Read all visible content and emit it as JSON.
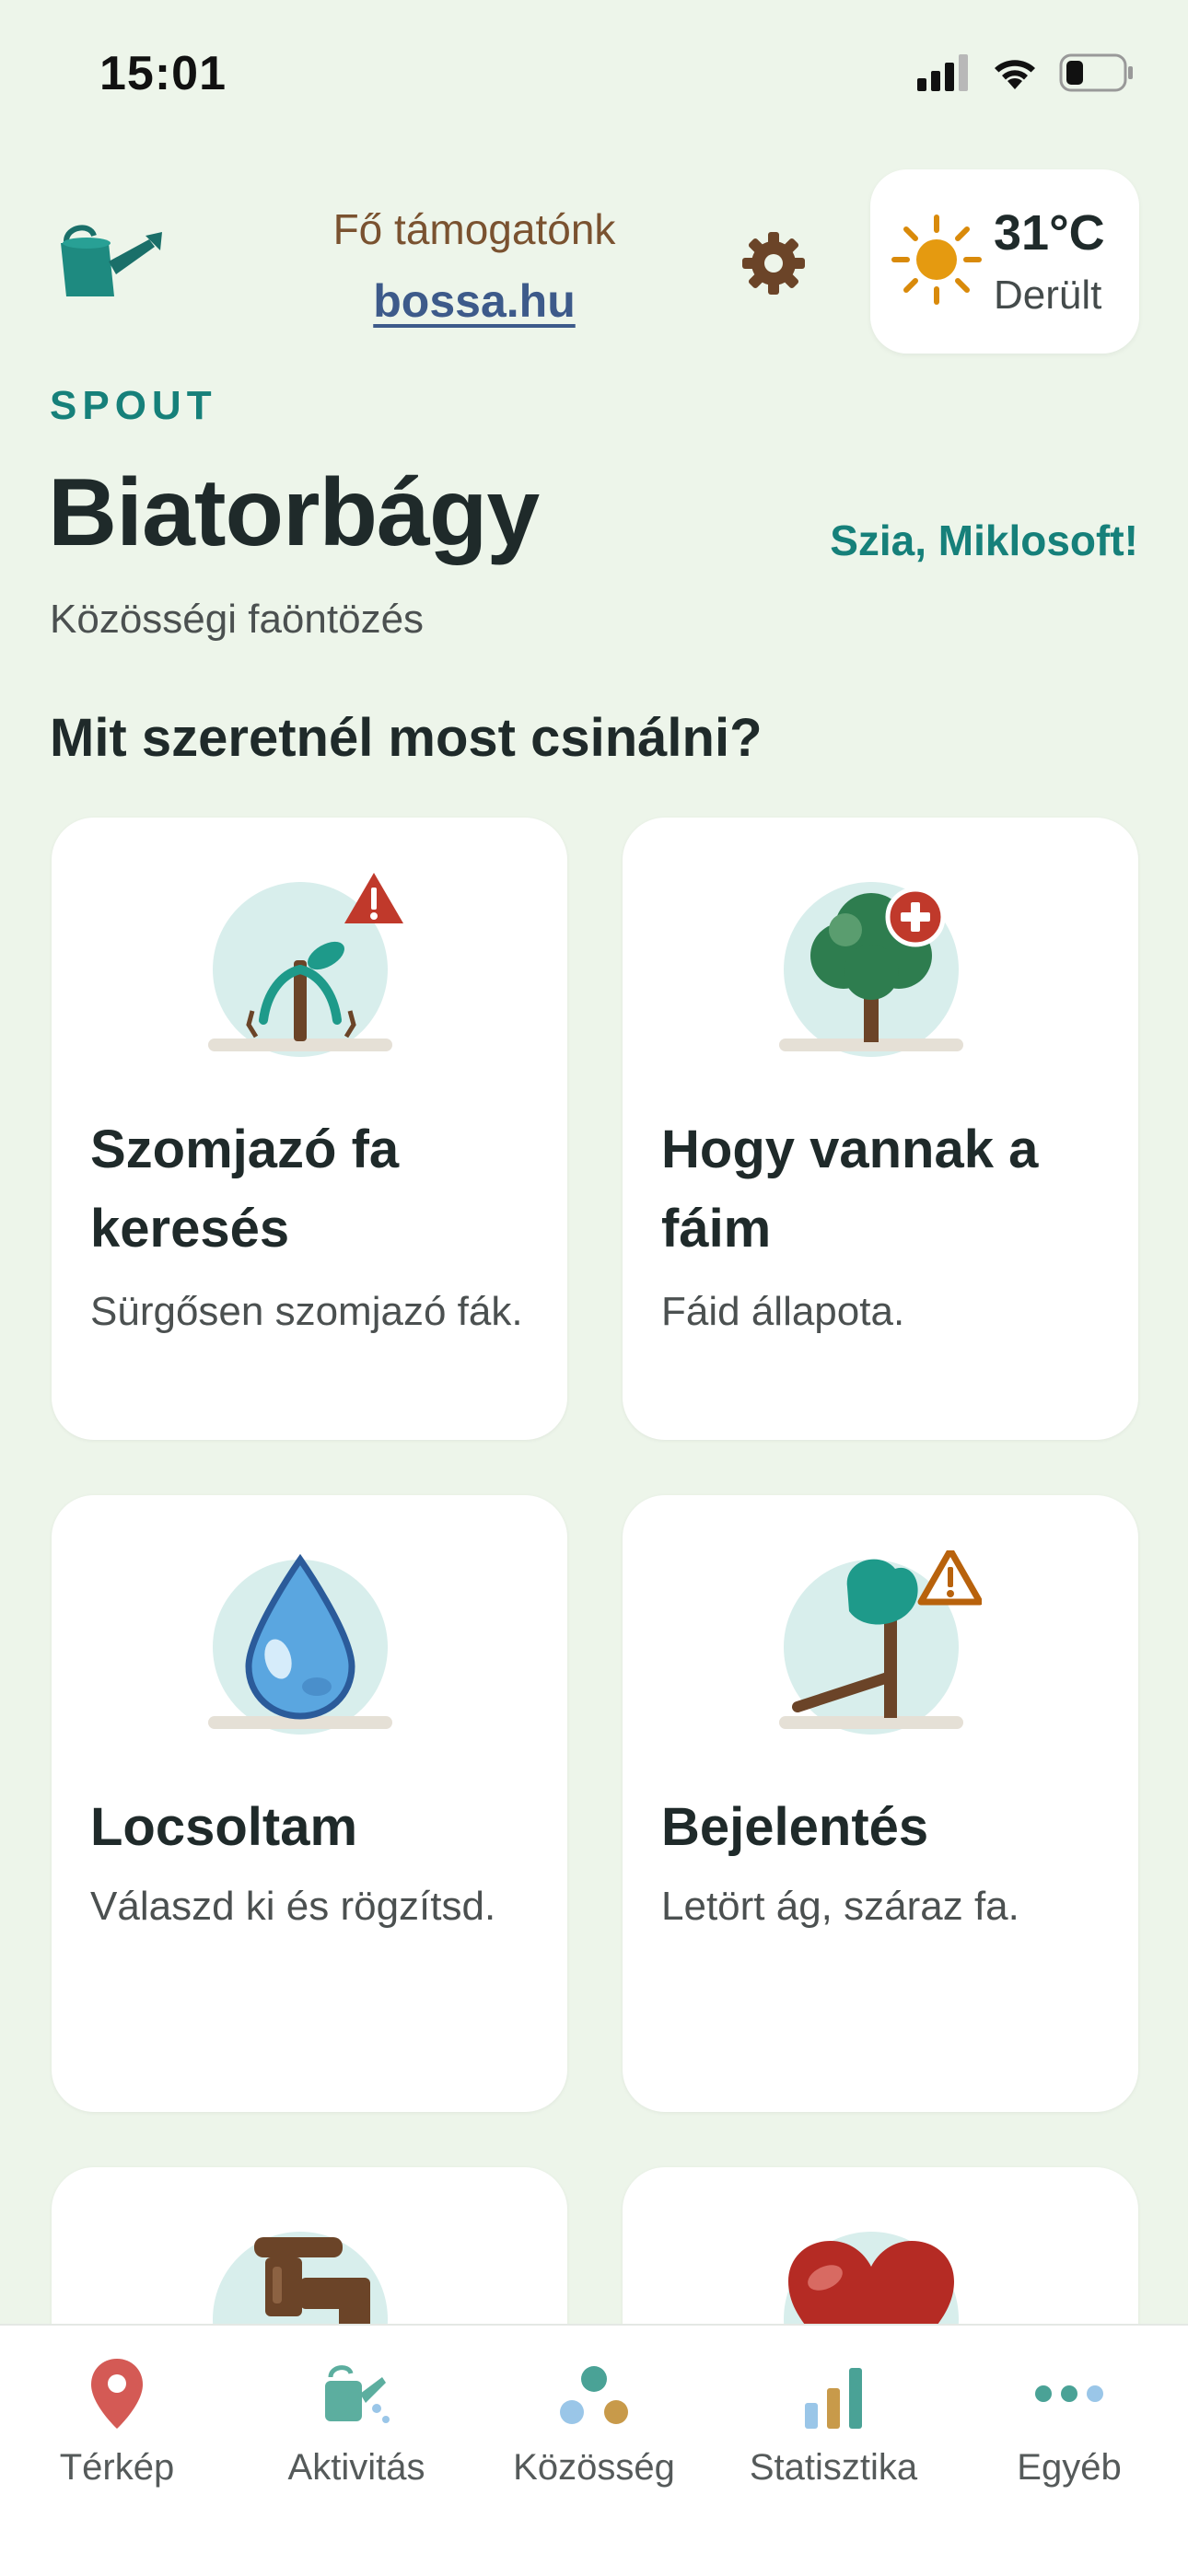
{
  "status_bar": {
    "time": "15:01"
  },
  "header": {
    "sponsor_label": "Fő támogatónk",
    "sponsor_link": "bossa.hu",
    "weather": {
      "temperature": "31°C",
      "condition": "Derült"
    }
  },
  "brand": "SPOUT",
  "city": "Biatorbágy",
  "greeting": "Szia, Miklosoft!",
  "subtitle": "Közösségi faöntözés",
  "question": "Mit szeretnél most csinálni?",
  "cards": [
    {
      "title": "Szomjazó fa keresés",
      "desc": "Sürgősen szomjazó fák."
    },
    {
      "title": "Hogy vannak a fáim",
      "desc": "Fáid állapota."
    },
    {
      "title": "Locsoltam",
      "desc": "Válaszd ki és rögzítsd."
    },
    {
      "title": "Bejelentés",
      "desc": "Letört ág, száraz fa."
    }
  ],
  "tabs": [
    {
      "label": "Térkép",
      "icon": "map-pin-icon"
    },
    {
      "label": "Aktivitás",
      "icon": "watering-can-icon"
    },
    {
      "label": "Közösség",
      "icon": "community-dots-icon"
    },
    {
      "label": "Statisztika",
      "icon": "bar-chart-icon"
    },
    {
      "label": "Egyéb",
      "icon": "more-dots-icon"
    }
  ],
  "colors": {
    "background": "#edf5ea",
    "accent_teal": "#16807a",
    "sponsor_brown": "#7a5230",
    "link_blue": "#3d5a8a",
    "alert_red": "#c0392b",
    "warning_orange": "#b8620c"
  }
}
